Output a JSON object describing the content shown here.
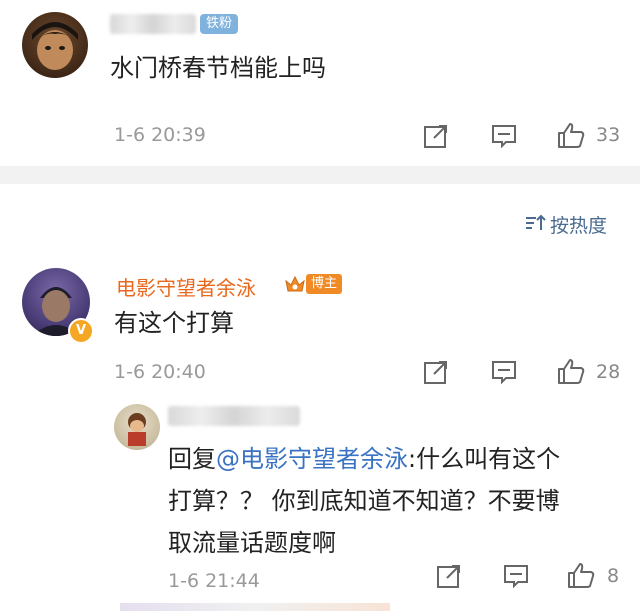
{
  "comments": [
    {
      "badge": "铁粉",
      "text": "水门桥春节档能上吗",
      "time": "1-6 20:39",
      "likes": "33"
    }
  ],
  "sort_label": "按热度",
  "reply_thread": {
    "author": "电影守望者余泳",
    "host_badge": "博主",
    "text": "有这个打算",
    "time": "1-6 20:40",
    "likes": "28",
    "reply": {
      "prefix": "回复",
      "mention": "@电影守望者余泳",
      "body_line1": ":什么叫有这个",
      "body_line2": "打算？？ 你到底知道不知道？不要博",
      "body_line3": "取流量话题度啊",
      "time": "1-6 21:44",
      "likes": "8"
    }
  },
  "icons": {
    "forward": "share-icon",
    "comment": "comment-icon",
    "like": "thumbs-up-icon",
    "verified": "verified-v-icon",
    "sort": "sort-icon"
  },
  "colors": {
    "username": "#e8691e",
    "mention": "#3a73c4",
    "fan_badge": "#7fb2dd",
    "host_badge": "#f08a27"
  }
}
